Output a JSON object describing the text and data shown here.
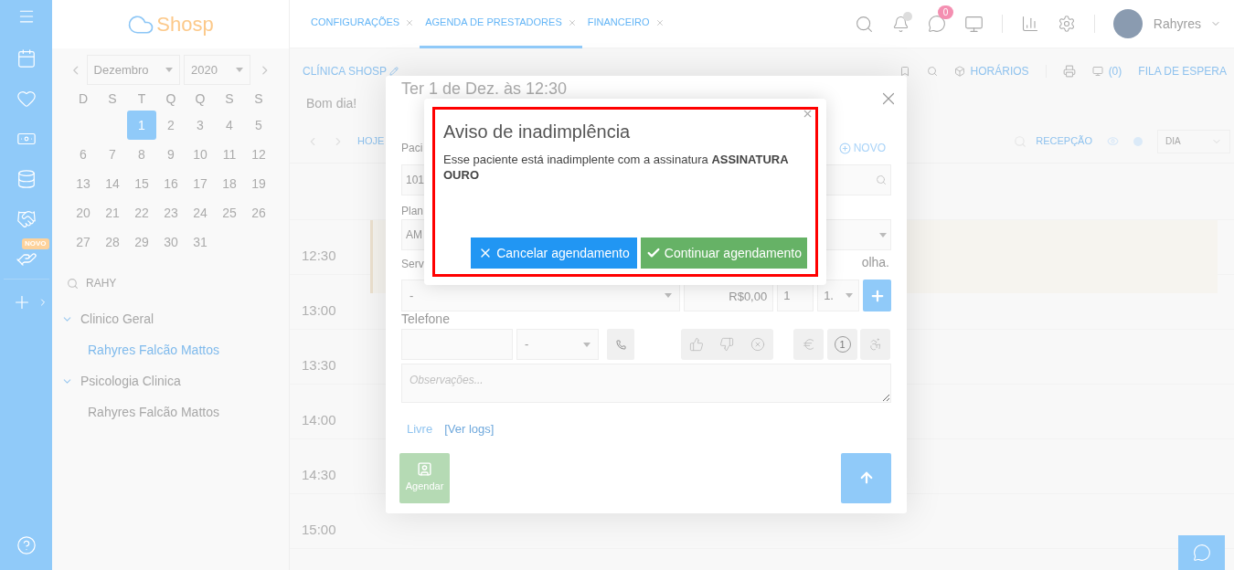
{
  "rail": {
    "badge": "NOVO"
  },
  "header": {
    "logo": "Shosp",
    "tabs": [
      {
        "label": "CONFIGURAÇÕES",
        "selected": false
      },
      {
        "label": "AGENDA DE PRESTADORES",
        "selected": true
      },
      {
        "label": "FINANCEIRO",
        "selected": false
      }
    ],
    "messages_badge": "0",
    "user": "Rahyres"
  },
  "calendar": {
    "month": "Dezembro",
    "year": "2020",
    "weekdays": [
      "D",
      "S",
      "T",
      "Q",
      "Q",
      "S",
      "S"
    ],
    "weeks": [
      [
        {
          "label": "1",
          "selected": true
        },
        {
          "label": "2",
          "selected": false
        },
        {
          "label": "3",
          "selected": false
        },
        {
          "label": "4",
          "selected": false
        },
        {
          "label": "5",
          "selected": false
        }
      ],
      [
        {
          "label": "6",
          "selected": false
        },
        {
          "label": "7",
          "selected": false
        },
        {
          "label": "8",
          "selected": false
        },
        {
          "label": "9",
          "selected": false
        },
        {
          "label": "10",
          "selected": false
        },
        {
          "label": "11",
          "selected": false
        },
        {
          "label": "12",
          "selected": false
        }
      ],
      [
        {
          "label": "13",
          "selected": false
        },
        {
          "label": "14",
          "selected": false
        },
        {
          "label": "15",
          "selected": false
        },
        {
          "label": "16",
          "selected": false
        },
        {
          "label": "17",
          "selected": false
        },
        {
          "label": "18",
          "selected": false
        },
        {
          "label": "19",
          "selected": false
        }
      ],
      [
        {
          "label": "20",
          "selected": false
        },
        {
          "label": "21",
          "selected": false
        },
        {
          "label": "22",
          "selected": false
        },
        {
          "label": "23",
          "selected": false
        },
        {
          "label": "24",
          "selected": false
        },
        {
          "label": "25",
          "selected": false
        },
        {
          "label": "26",
          "selected": false
        }
      ],
      [
        {
          "label": "27",
          "selected": false
        },
        {
          "label": "28",
          "selected": false
        },
        {
          "label": "29",
          "selected": false
        },
        {
          "label": "30",
          "selected": false
        },
        {
          "label": "31",
          "selected": false
        }
      ]
    ]
  },
  "search": {
    "value": "RAHY"
  },
  "tree": [
    {
      "label": "Clinico Geral",
      "expanded": true,
      "children": [
        {
          "label": "Rahyres Falcão Mattos",
          "selected": true
        }
      ]
    },
    {
      "label": "Psicologia Clinica",
      "expanded": true,
      "children": [
        {
          "label": "Rahyres Falcão Mattos",
          "selected": false
        }
      ]
    }
  ],
  "agenda": {
    "clinic": "CLÍNICA SHOSP",
    "schedules": "HORÁRIOS",
    "waiting_count": "(0)",
    "queue": "FILA DE ESPERA",
    "greeting": "Bom dia!",
    "today": "HOJE",
    "room": "RECEPÇÃO",
    "view": "DIA",
    "times": [
      "12:30",
      "13:00",
      "13:30",
      "14:00",
      "14:30",
      "15:00"
    ]
  },
  "modal": {
    "title": "Ter 1 de Dez. às 12:30",
    "patient_label": "Paci",
    "new_link": "NOVO",
    "patient_value": "101",
    "plan_label": "Plan",
    "plan_value": "AM",
    "service_label": "Serv",
    "service_hint": "olha.",
    "service_value": "-",
    "price": "R$0,00",
    "quantity": "1",
    "unit": "1.",
    "phone_label": "Telefone",
    "phone_type": "-",
    "counter_icon": "1",
    "notes_placeholder": "Observações...",
    "status": "Livre",
    "logs_link": "[Ver logs]",
    "schedule_button": "Agendar"
  },
  "alert": {
    "title": "Aviso de inadimplência",
    "message": "Esse paciente está inadimplente com a assinatura **ASSINATURA OURO**",
    "cancel": "Cancelar agendamento",
    "confirm": "Continuar agendamento"
  }
}
